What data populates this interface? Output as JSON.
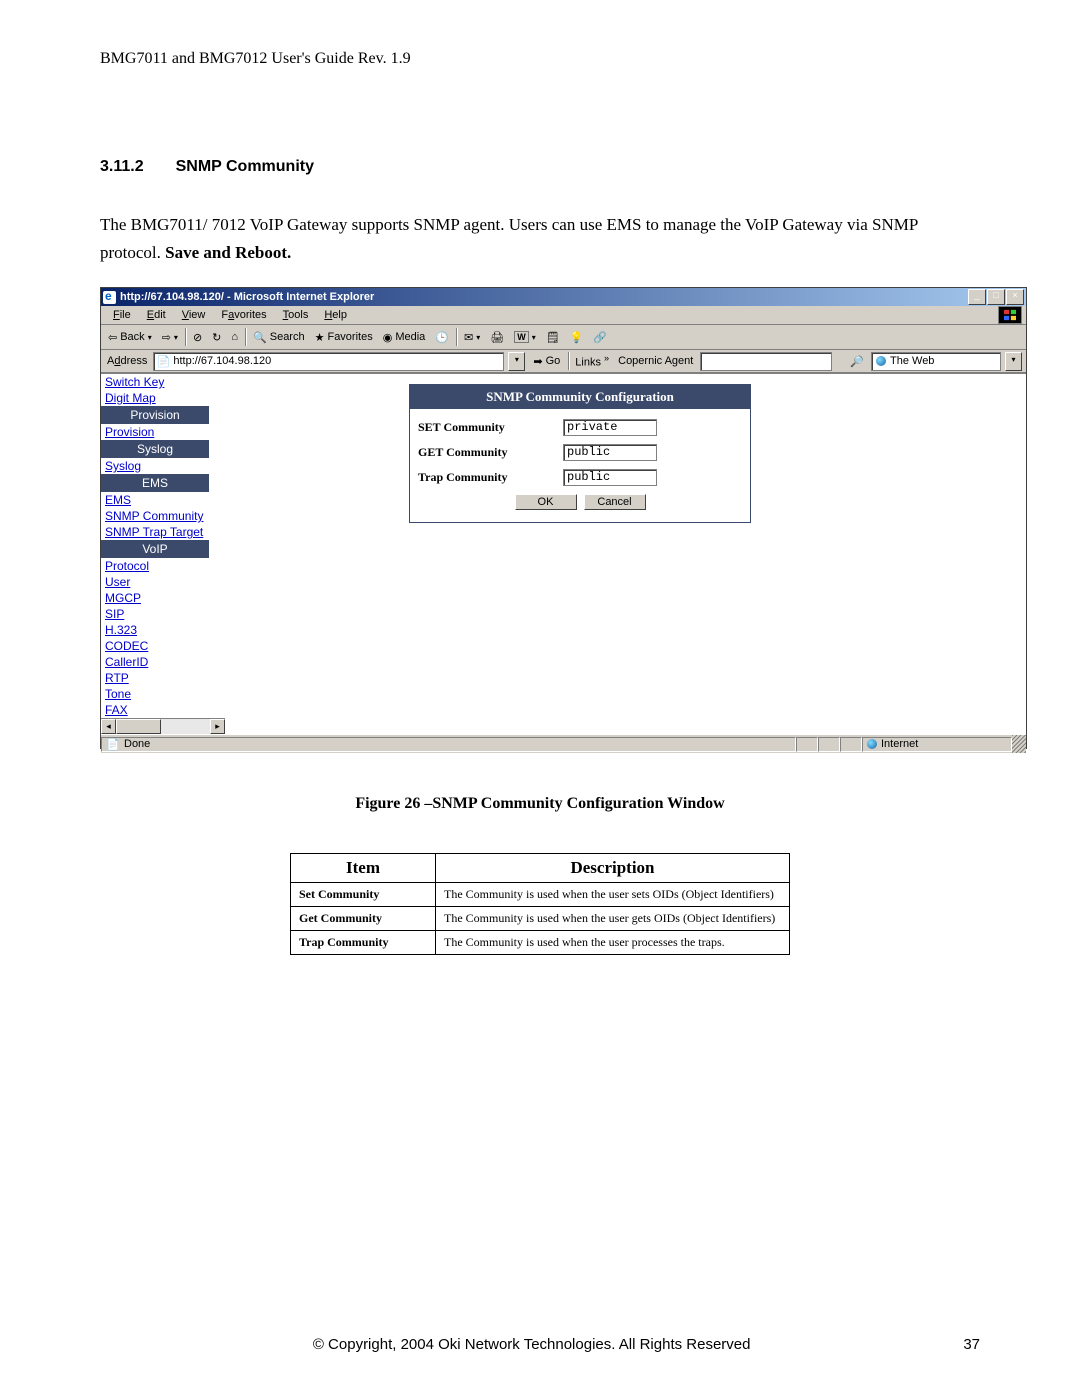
{
  "doc_header": "BMG7011 and BMG7012 User's Guide Rev. 1.9",
  "section": {
    "number": "3.11.2",
    "title": "SNMP Community"
  },
  "body_text_1": "The BMG7011/ 7012 VoIP Gateway supports SNMP agent. Users can use EMS to manage the VoIP Gateway via SNMP protocol. ",
  "body_text_bold": "Save and Reboot.",
  "browser": {
    "title": "http://67.104.98.120/ - Microsoft Internet Explorer",
    "menus": [
      "File",
      "Edit",
      "View",
      "Favorites",
      "Tools",
      "Help"
    ],
    "toolbar": {
      "back": "Back",
      "search": "Search",
      "favorites": "Favorites",
      "media": "Media"
    },
    "address_label": "Address",
    "address_value": "http://67.104.98.120",
    "go": "Go",
    "links": "Links",
    "copernic": "Copernic Agent",
    "webcombo": "The Web",
    "winbtns": {
      "min": "_",
      "max": "□",
      "close": "×"
    },
    "statusbar": {
      "done": "Done",
      "zone": "Internet"
    }
  },
  "sidebar": {
    "items": [
      {
        "type": "link",
        "label": "Switch Key"
      },
      {
        "type": "link",
        "label": "Digit Map"
      },
      {
        "type": "hdr",
        "label": "Provision"
      },
      {
        "type": "link",
        "label": "Provision"
      },
      {
        "type": "hdr",
        "label": "Syslog"
      },
      {
        "type": "link",
        "label": "Syslog"
      },
      {
        "type": "hdr",
        "label": "EMS"
      },
      {
        "type": "link",
        "label": "EMS"
      },
      {
        "type": "link",
        "label": "SNMP Community"
      },
      {
        "type": "link",
        "label": "SNMP Trap Target"
      },
      {
        "type": "hdr",
        "label": "VoIP"
      },
      {
        "type": "link",
        "label": "Protocol"
      },
      {
        "type": "link",
        "label": "User"
      },
      {
        "type": "link",
        "label": "MGCP"
      },
      {
        "type": "link",
        "label": "SIP"
      },
      {
        "type": "link",
        "label": "H.323"
      },
      {
        "type": "link",
        "label": "CODEC"
      },
      {
        "type": "link",
        "label": "CallerID"
      },
      {
        "type": "link",
        "label": "RTP"
      },
      {
        "type": "link",
        "label": "Tone"
      },
      {
        "type": "link",
        "label": "FAX"
      }
    ]
  },
  "panel": {
    "title": "SNMP Community Configuration",
    "rows": [
      {
        "label": "SET Community",
        "value": "private"
      },
      {
        "label": "GET Community",
        "value": "public"
      },
      {
        "label": "Trap Community",
        "value": "public"
      }
    ],
    "buttons": {
      "ok": "OK",
      "cancel": "Cancel"
    }
  },
  "figure_caption": "Figure 26 –SNMP Community Configuration Window",
  "desc_table": {
    "headers": [
      "Item",
      "Description"
    ],
    "rows": [
      {
        "item": "Set Community",
        "desc": "The Community is used when the user sets OIDs (Object Identifiers)"
      },
      {
        "item": "Get Community",
        "desc": "The Community is used when the user gets OIDs (Object Identifiers)"
      },
      {
        "item": "Trap Community",
        "desc": "The Community is used when the user processes the traps."
      }
    ]
  },
  "footer": {
    "copyright": "© Copyright, 2004 Oki Network Technologies. All Rights Reserved",
    "page": "37"
  }
}
